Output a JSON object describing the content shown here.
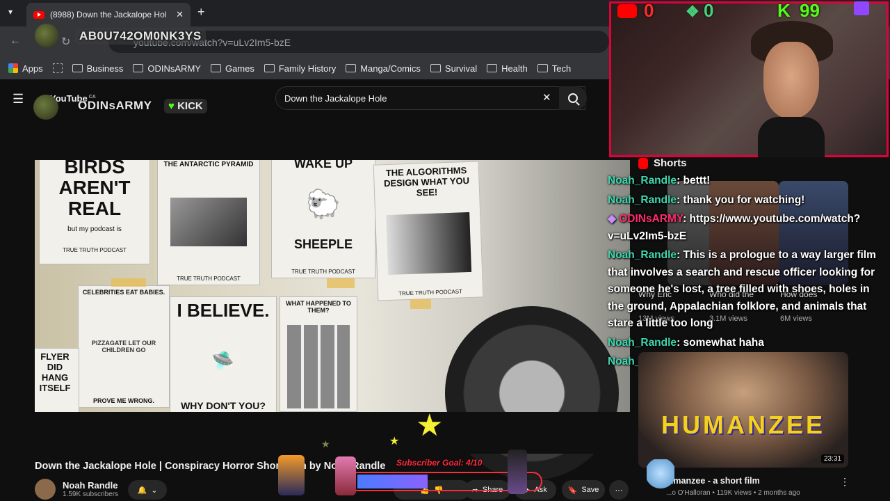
{
  "browser": {
    "tab_title": "(8988) Down the Jackalope Hol",
    "address": "youtube.com/watch?v=uLv2Im5-bzE",
    "bookmarks": [
      "Apps",
      "Business",
      "ODINsARMY",
      "Games",
      "Family History",
      "Manga/Comics",
      "Survival",
      "Health",
      "Tech"
    ]
  },
  "overlay": {
    "handle": "AB0U742OM0NK3YS",
    "brand": "ODINsARMY",
    "kick": "KICK",
    "counters": {
      "youtube": "0",
      "green": "0",
      "kick": "99"
    },
    "youtube_logo": "YouTube",
    "youtube_region": "CA"
  },
  "search": {
    "query": "Down the Jackalope Hole"
  },
  "video_posters": {
    "birds": "BIRDS AREN'T REAL",
    "birds_sub": "but my podcast is",
    "pyramid": "THE ANTARCTIC PYRAMID",
    "wake": "WAKE UP",
    "sheeple": "SHEEPLE",
    "algo": "THE ALGORITHMS DESIGN WHAT YOU SEE!",
    "celebs": "CELEBRITIES EAT BABIES.",
    "believe": "I BELIEVE.",
    "why": "WHY DON'T YOU?",
    "happened": "WHAT HAPPENED TO THEM?",
    "wrong": "PROVE ME WRONG.",
    "flyer": "FLYER DID HANG ITSELF",
    "podcast": "TRUE TRUTH PODCAST",
    "pizza": "PIZZAGATE LET OUR CHILDREN GO"
  },
  "shorts": {
    "label": "Shorts"
  },
  "chat": [
    {
      "user": "Noah_Randle",
      "msg": ": bettt!",
      "color": "#3fd8b0"
    },
    {
      "user": "Noah_Randle",
      "msg": ": thank you for watching!",
      "color": "#3fd8b0"
    },
    {
      "user": "ODINsARMY",
      "msg": ": https://www.youtube.com/watch?v=uLv2Im5-bzE",
      "color": "#ff2c6e"
    },
    {
      "user": "Noah_Randle",
      "msg": ": This is a prologue to a way larger film that involves a search and rescue officer looking for someone he's lost, a tree filled with shoes, holes in the ground, Appalachian folklore, and animals that stare a little too long",
      "color": "#3fd8b0"
    },
    {
      "user": "Noah_Randle",
      "msg": ": somewhat haha",
      "color": "#3fd8b0"
    },
    {
      "user": "Noah_Randle",
      "msg": ": 😂",
      "color": "#3fd8b0"
    }
  ],
  "shorts_items": [
    {
      "title": "Why Eric",
      "views": "13M views"
    },
    {
      "title": "Who did the",
      "views": "3.1M views"
    },
    {
      "title": "How does",
      "views": "6M views"
    }
  ],
  "recommended": {
    "title": "...manzee - a short film",
    "thumb_title": "HUMANZEE",
    "duration": "23:31",
    "meta": "...o O'Halloran • 119K views • 2 months ago"
  },
  "video": {
    "title": "Down the Jackalope Hole | Conspiracy Horror Short Film by Noah Randle",
    "channel": "Noah Randle",
    "subscribers": "1.59K subscribers",
    "share": "Share",
    "ask": "Ask",
    "save": "Save"
  },
  "goal": {
    "label": "Subscriber Goal: 4/10",
    "current": 4,
    "target": 10
  }
}
